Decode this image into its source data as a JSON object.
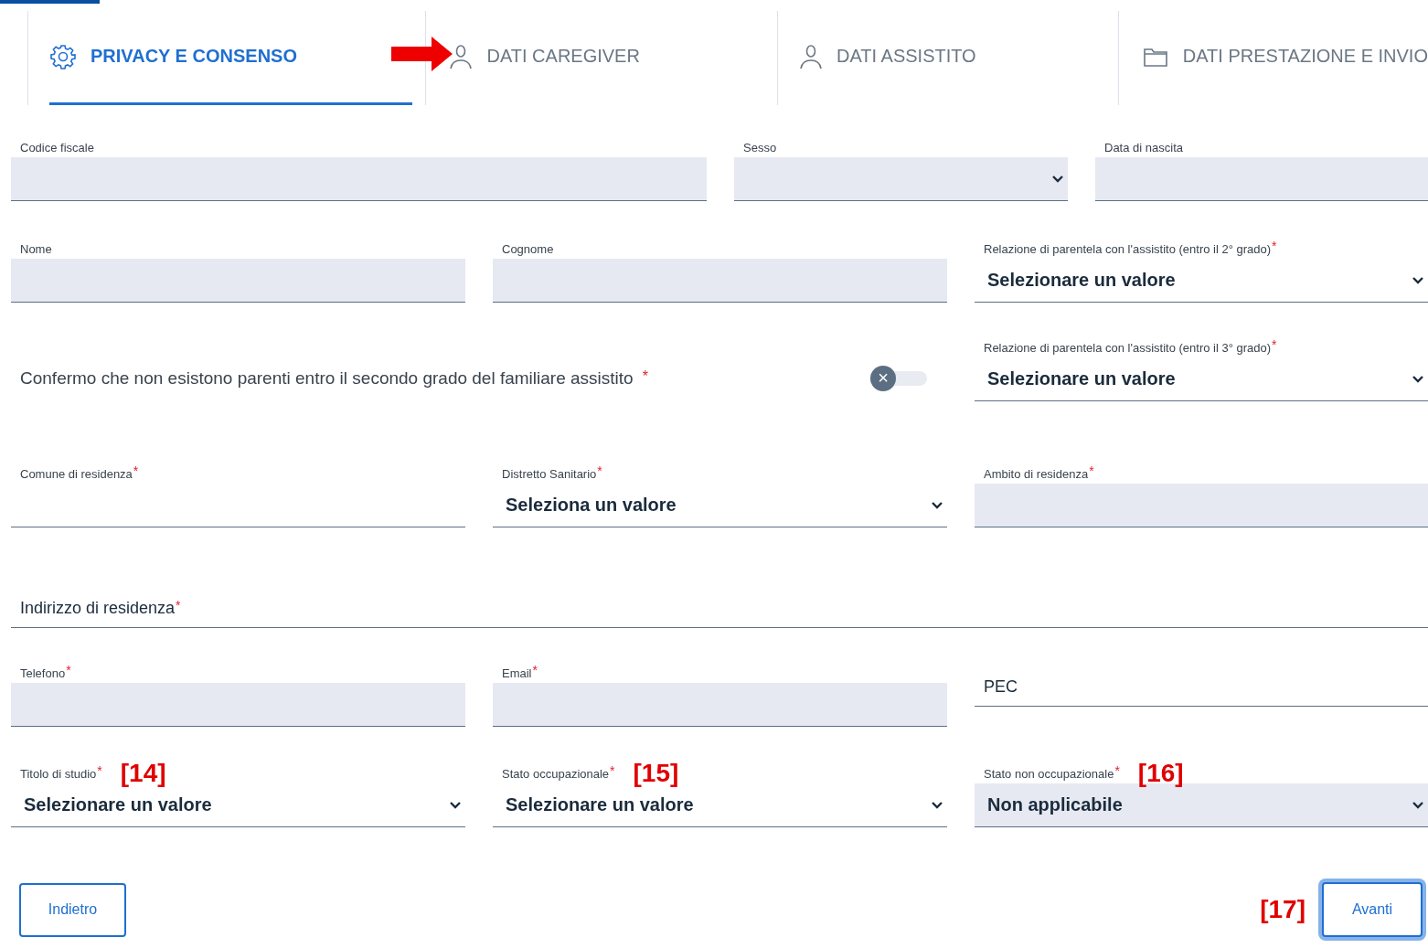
{
  "required_mark": "*",
  "tabs": [
    {
      "label": "PRIVACY E CONSENSO",
      "selected": true
    },
    {
      "label": "DATI CAREGIVER",
      "selected": false
    },
    {
      "label": "DATI ASSISTITO",
      "selected": false
    },
    {
      "label": "DATI PRESTAZIONE E INVIO",
      "selected": false
    }
  ],
  "rows": [
    {
      "kind": "identity",
      "fields": [
        {
          "kind": "input",
          "label": "Codice fiscale",
          "required": false,
          "filled": true
        },
        {
          "kind": "select",
          "label": "Sesso",
          "required": false,
          "filled": true
        },
        {
          "kind": "input",
          "label": "Data di nascita",
          "required": false,
          "filled": true
        }
      ]
    },
    {
      "kind": "triple",
      "fields": [
        {
          "kind": "input",
          "label": "Nome",
          "required": false,
          "filled": true
        },
        {
          "kind": "input",
          "label": "Cognome",
          "required": false,
          "filled": true
        },
        {
          "kind": "select",
          "label": "Relazione di parentela con l'assistito (entro il 2° grado)",
          "required": true,
          "filled": false,
          "value": "Selezionare un valore"
        }
      ]
    },
    {
      "kind": "confirm",
      "confirm": {
        "text": "Confermo che non esistono parenti entro il secondo grado del familiare assistito",
        "required": true,
        "on": false,
        "off_glyph": "×"
      },
      "fields": [
        {
          "kind": "select",
          "label": "Relazione di parentela con l'assistito (entro il 3° grado)",
          "required": true,
          "filled": false,
          "value": "Selezionare un valore"
        }
      ]
    },
    {
      "kind": "triple",
      "fields": [
        {
          "kind": "input",
          "label": "Comune di residenza",
          "required": true,
          "filled": false
        },
        {
          "kind": "select",
          "label": "Distretto Sanitario",
          "required": true,
          "filled": false,
          "value": "Seleziona un valore"
        },
        {
          "kind": "input",
          "label": "Ambito di residenza",
          "required": true,
          "filled": true
        }
      ]
    },
    {
      "kind": "full",
      "fields": [
        {
          "kind": "inline",
          "label": "Indirizzo di residenza",
          "required": true
        }
      ]
    },
    {
      "kind": "triple",
      "fields": [
        {
          "kind": "input",
          "label": "Telefono",
          "required": true,
          "filled": true
        },
        {
          "kind": "input",
          "label": "Email",
          "required": true,
          "filled": true
        },
        {
          "kind": "inline",
          "label": "PEC",
          "required": false
        }
      ]
    },
    {
      "kind": "triple",
      "fields": [
        {
          "kind": "select",
          "label": "Titolo di studio",
          "required": true,
          "filled": false,
          "value": "Selezionare un valore",
          "annotation": "[14]"
        },
        {
          "kind": "select",
          "label": "Stato occupazionale",
          "required": true,
          "filled": false,
          "value": "Selezionare un valore",
          "annotation": "[15]"
        },
        {
          "kind": "select",
          "label": "Stato non occupazionale",
          "required": true,
          "filled": true,
          "value": "Non applicabile",
          "annotation": "[16]"
        }
      ]
    }
  ],
  "buttons": [
    {
      "label": "Indietro",
      "focused": false
    },
    {
      "label": "Avanti",
      "focused": true,
      "annotation": "[17]"
    }
  ]
}
